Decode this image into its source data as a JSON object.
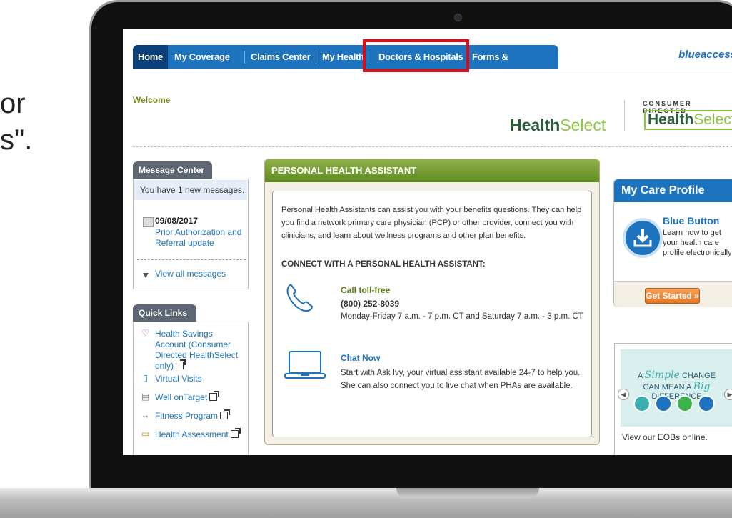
{
  "slide": {
    "line1": "or",
    "line2": "s\"."
  },
  "nav": {
    "items": [
      "Home",
      "My Coverage",
      "Claims Center",
      "My Health",
      "Doctors & Hospitals",
      "Forms & Documents"
    ],
    "highlighted": "Doctors & Hospitals",
    "brand": "blueaccess"
  },
  "header": {
    "welcome": "Welcome",
    "logo1_a": "Health",
    "logo1_b": "Select",
    "cd_label": "CONSUMER DIRECTED",
    "logo2_a": "Health",
    "logo2_b": "Select"
  },
  "message_center": {
    "title": "Message Center",
    "new_messages": "You have 1 new messages.",
    "date": "09/08/2017",
    "subject": "Prior Authorization and Referral update",
    "view_all": "View all messages"
  },
  "quick_links": {
    "title": "Quick Links",
    "items": [
      "Health Savings Account (Consumer Directed HealthSelect only)",
      "Virtual Visits",
      "Well onTarget",
      "Fitness Program",
      "Health Assessment"
    ]
  },
  "pha": {
    "title": "PERSONAL HEALTH ASSISTANT",
    "intro": "Personal Health Assistants can assist you with your benefits questions. They can help you find a network primary care physician (PCP) or other provider, connect you with clinicians, and learn about wellness programs and other plan benefits.",
    "connect": "CONNECT WITH A PERSONAL HEALTH ASSISTANT:",
    "call_title": "Call toll-free",
    "call_phone": "(800) 252-8039",
    "call_hours": "Monday-Friday 7 a.m. - 7 p.m. CT and Saturday 7 a.m. - 3 p.m. CT",
    "chat_title": "Chat Now",
    "chat_desc": "Start with Ask Ivy, your virtual assistant available 24-7 to help you. She can also connect you to live chat when PHAs are available."
  },
  "care_profile": {
    "title": "My Care Profile",
    "bb_title": "Blue Button",
    "bb_desc": "Learn how to get your health care profile electronically",
    "button": "Get Started »"
  },
  "eob": {
    "line1": "A",
    "simple": "Simple",
    "line1b": "CHANGE",
    "line2": "CAN MEAN A",
    "big": "Big",
    "line2b": "DIFFERENCE",
    "text": "View our EOBs online."
  }
}
